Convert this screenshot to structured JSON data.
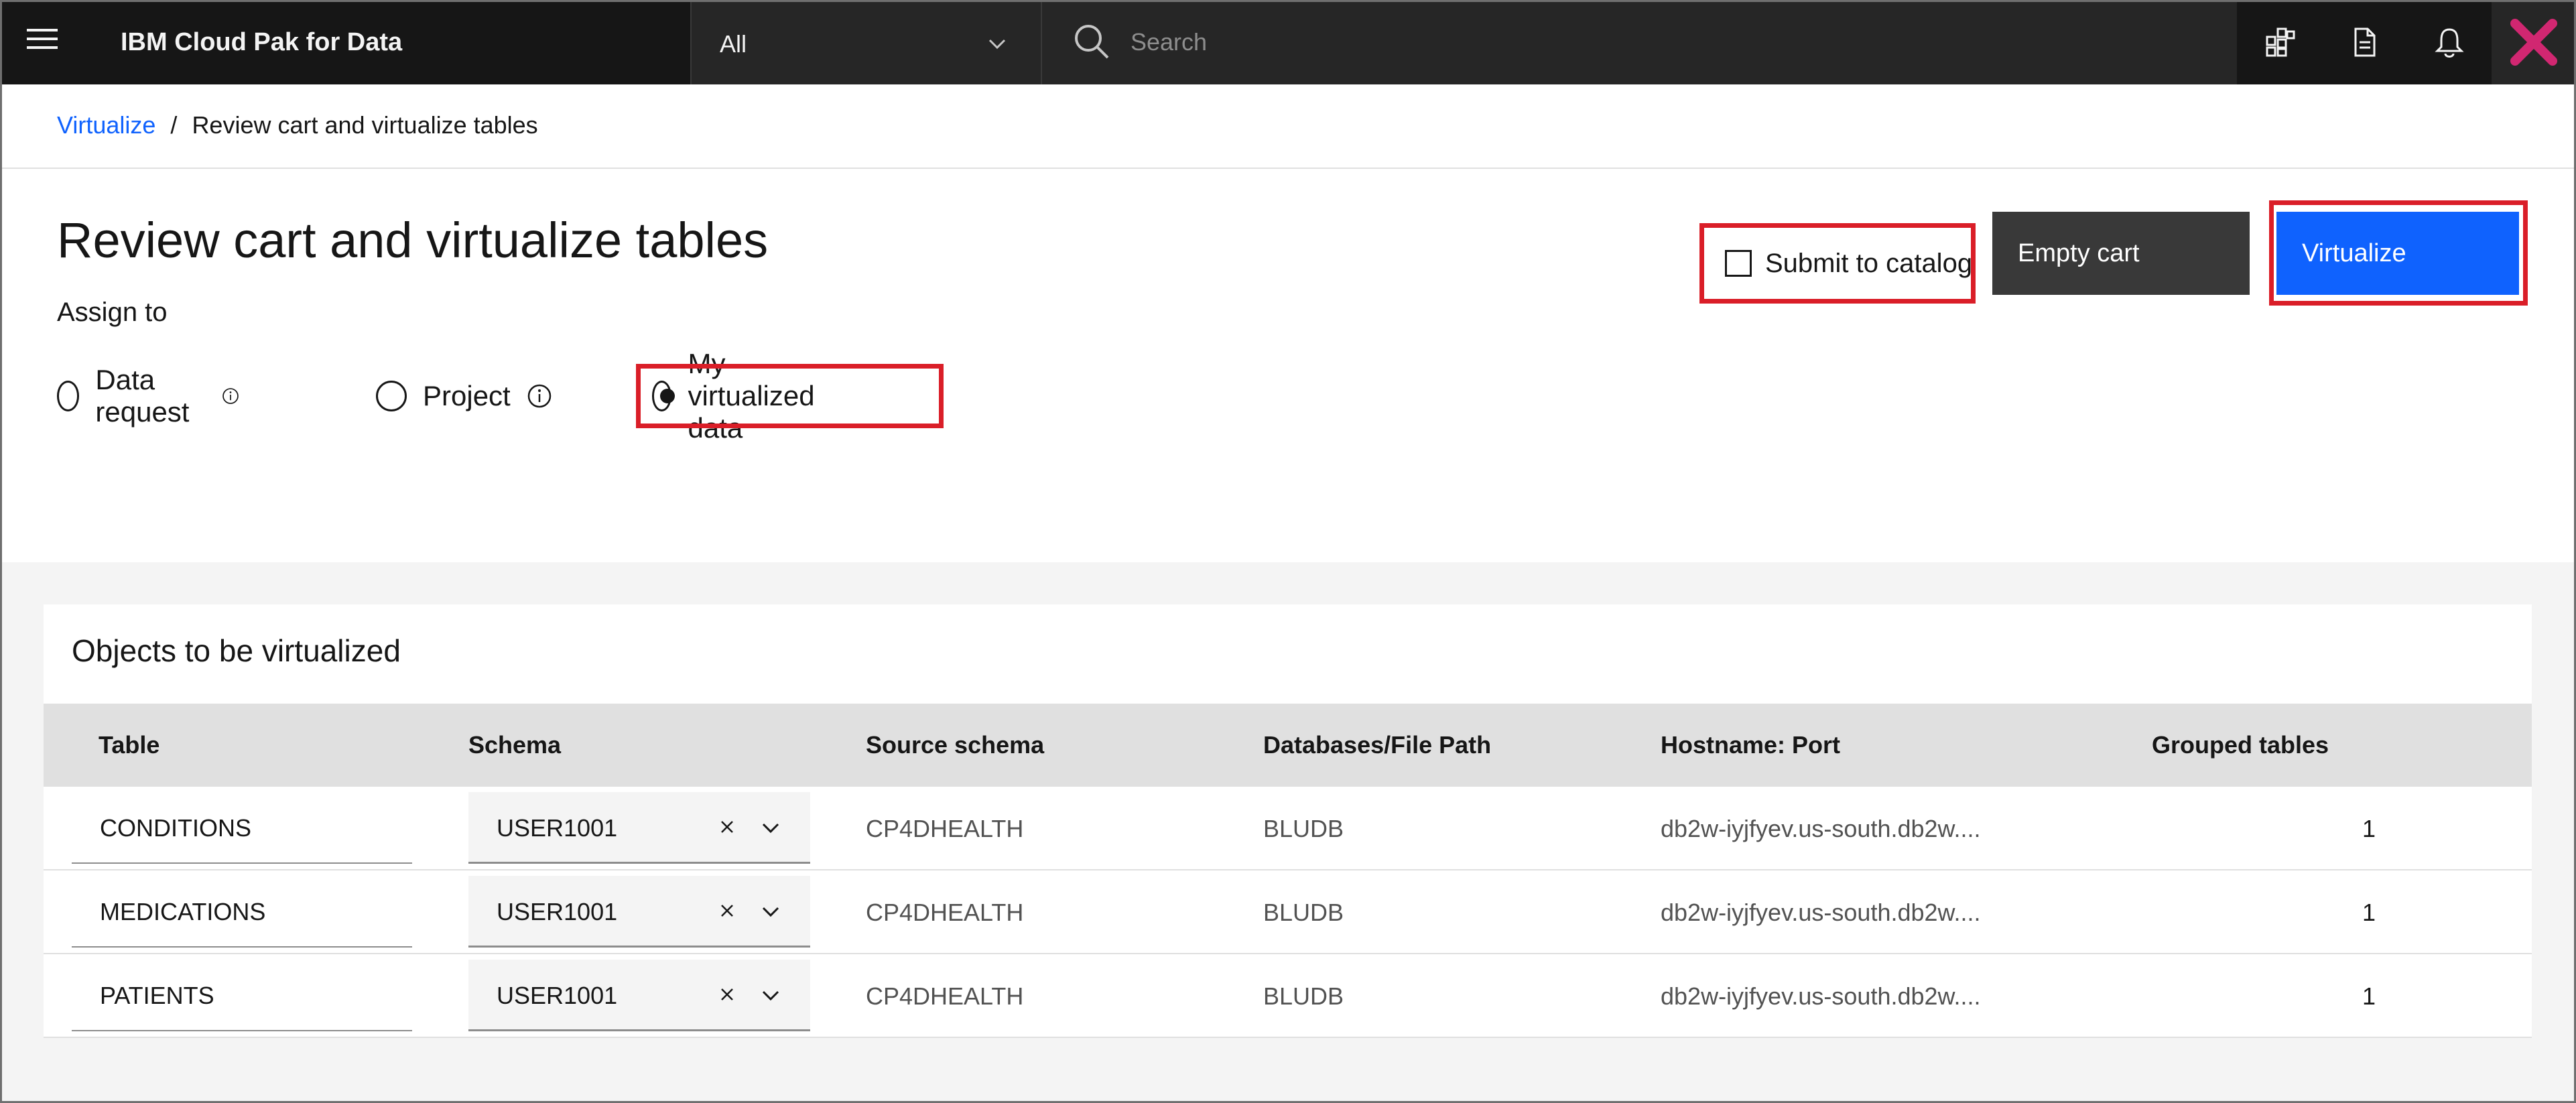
{
  "topbar": {
    "brand": "IBM Cloud Pak for Data",
    "scope_value": "All",
    "search_placeholder": "Search"
  },
  "breadcrumb": {
    "parent": "Virtualize",
    "separator": "/",
    "current": "Review cart and virtualize tables"
  },
  "page": {
    "title": "Review cart and virtualize tables",
    "assign_label": "Assign to",
    "radios": [
      {
        "label": "Data request",
        "selected": false
      },
      {
        "label": "Project",
        "selected": false
      },
      {
        "label": "My virtualized data",
        "selected": true
      }
    ],
    "submit_to_catalog": "Submit to catalog",
    "empty_cart": "Empty cart",
    "virtualize": "Virtualize"
  },
  "table": {
    "title": "Objects to be virtualized",
    "headers": [
      "Table",
      "Schema",
      "Source schema",
      "Databases/File Path",
      "Hostname: Port",
      "Grouped tables"
    ],
    "rows": [
      {
        "table": "CONDITIONS",
        "schema": "USER1001",
        "source_schema": "CP4DHEALTH",
        "database": "BLUDB",
        "hostname": "db2w-iyjfyev.us-south.db2w....",
        "grouped": "1"
      },
      {
        "table": "MEDICATIONS",
        "schema": "USER1001",
        "source_schema": "CP4DHEALTH",
        "database": "BLUDB",
        "hostname": "db2w-iyjfyev.us-south.db2w....",
        "grouped": "1"
      },
      {
        "table": "PATIENTS",
        "schema": "USER1001",
        "source_schema": "CP4DHEALTH",
        "database": "BLUDB",
        "hostname": "db2w-iyjfyev.us-south.db2w....",
        "grouped": "1"
      }
    ]
  },
  "colors": {
    "topbar": "#161616",
    "primary": "#0f62fe",
    "highlight": "#da1e28",
    "secondary_button": "#393939"
  }
}
